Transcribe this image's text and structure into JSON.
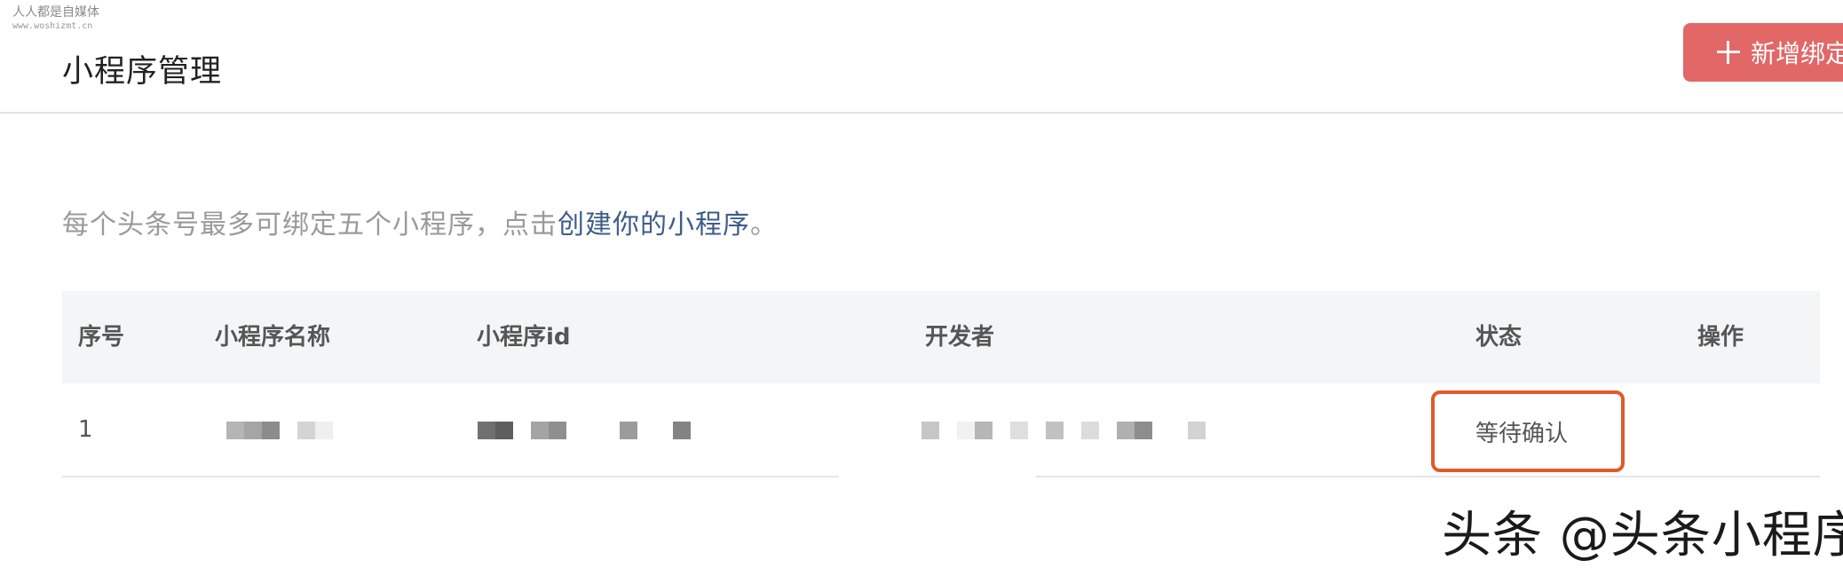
{
  "watermark": {
    "site_name": "人人都是自媒体",
    "site_url": "www.woshizmt.cn",
    "bottom_text": "头条 @头条小程序"
  },
  "header": {
    "title": "小程序管理",
    "add_button_label": "新增绑定"
  },
  "notice": {
    "prefix": "每个头条号最多可绑定五个小程序，点击",
    "link_text": "创建你的小程序",
    "suffix": "。"
  },
  "table": {
    "columns": [
      "序号",
      "小程序名称",
      "小程序id",
      "开发者",
      "状态",
      "操作"
    ],
    "rows": [
      {
        "index": "1",
        "name": "",
        "app_id": "",
        "developer": "",
        "status": "等待确认",
        "action": ""
      }
    ]
  },
  "colors": {
    "accent_button": "#e26767",
    "link": "#3e5d8a",
    "status_highlight": "#e05a2b",
    "header_bg": "#f4f5f6"
  }
}
